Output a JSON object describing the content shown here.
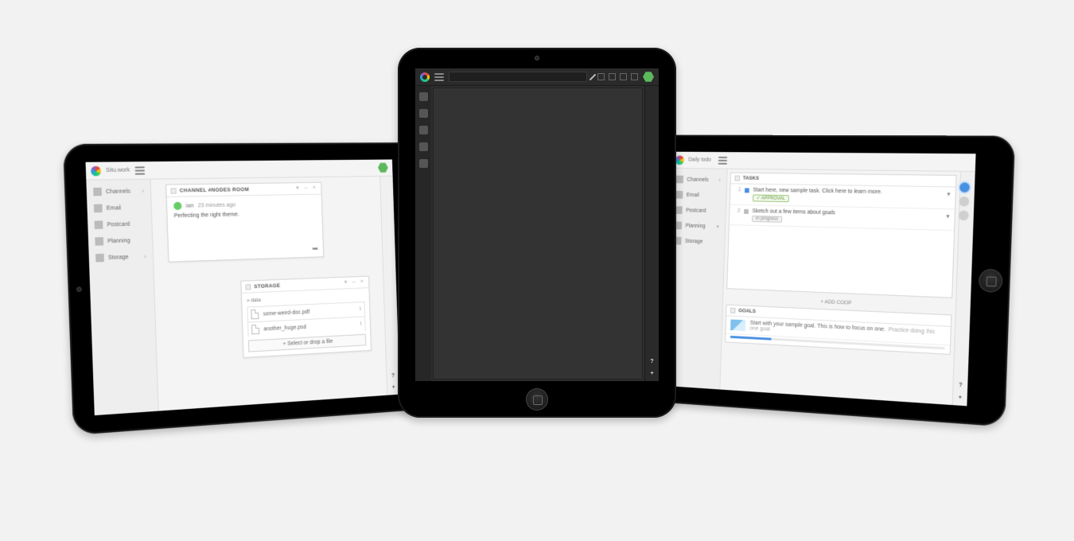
{
  "left": {
    "header": {
      "title": "Situ.work"
    },
    "sidebar": {
      "items": [
        {
          "label": "Channels"
        },
        {
          "label": "Email"
        },
        {
          "label": "Postcard"
        },
        {
          "label": "Planning"
        },
        {
          "label": "Storage"
        }
      ]
    },
    "channel_card": {
      "title": "CHANNEL #NODES ROOM",
      "author": "ian",
      "time": "23 minutes ago",
      "message": "Perfecting the right theme."
    },
    "storage_card": {
      "title": "STORAGE",
      "breadcrumb": "» data",
      "files": [
        {
          "name": "some-weird-doc.pdf"
        },
        {
          "name": "another_huge.psd"
        }
      ],
      "upload_label": "+ Select or drop a file"
    },
    "footer": {
      "help": "?",
      "add": "+"
    }
  },
  "center": {
    "toolbar_icons": [
      "pen",
      "chat",
      "video",
      "mic",
      "tag"
    ],
    "footer": {
      "help": "?",
      "add": "+"
    }
  },
  "right": {
    "header": {
      "title": "Daily todo"
    },
    "sidebar": {
      "items": [
        {
          "label": "Channels"
        },
        {
          "label": "Email"
        },
        {
          "label": "Postcard"
        },
        {
          "label": "Planning"
        },
        {
          "label": "Storage"
        }
      ]
    },
    "tasks_panel": {
      "title": "TASKS",
      "rows": [
        {
          "num": "1",
          "text": "Start here, new sample task. Click here to learn more.",
          "pill": "✓ APPROVAL"
        },
        {
          "num": "2",
          "text": "Sketch out a few items about goals",
          "pill": "in progress"
        }
      ],
      "add_label": "+ ADD COOP"
    },
    "goals_panel": {
      "title": "GOALS",
      "row_text": "Start with your sample goal. This is how to focus on one.",
      "hint": "Practice doing this one goal"
    },
    "footer": {
      "help": "?",
      "add": "+"
    }
  }
}
